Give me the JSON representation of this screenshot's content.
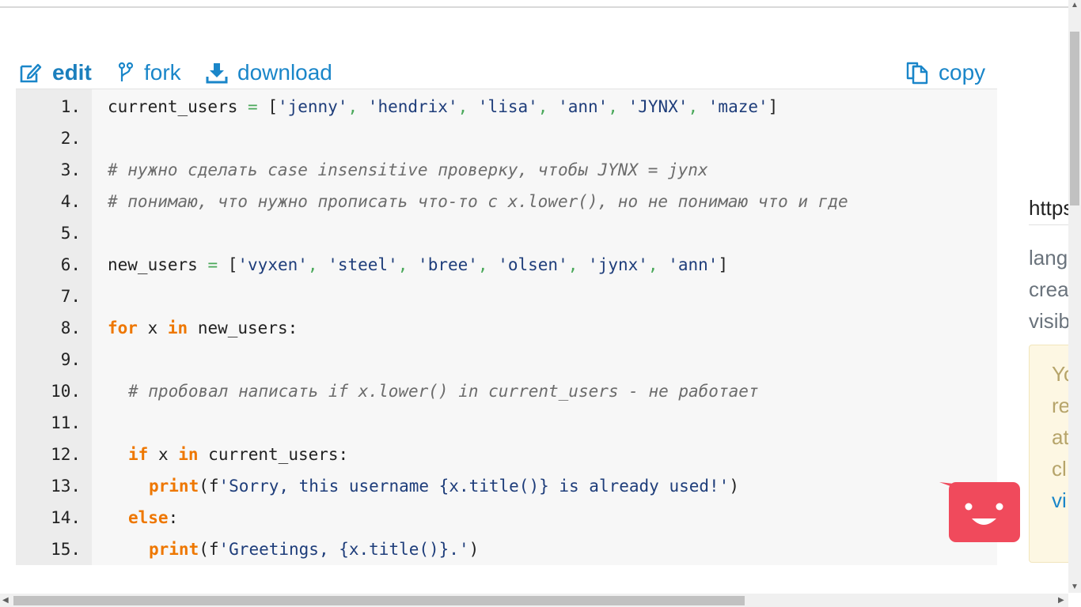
{
  "toolbar": {
    "edit": {
      "label": "edit",
      "icon": "edit-icon"
    },
    "fork": {
      "label": "fork",
      "icon": "fork-icon"
    },
    "download": {
      "label": "download",
      "icon": "download-icon"
    },
    "copy": {
      "label": "copy",
      "icon": "copy-icon"
    }
  },
  "code": {
    "line_numbers": [
      "1.",
      "2.",
      "3.",
      "4.",
      "5.",
      "6.",
      "7.",
      "8.",
      "9.",
      "10.",
      "11.",
      "12.",
      "13.",
      "14.",
      "15."
    ]
  },
  "sidebar": {
    "link_text": "https",
    "text_lines": [
      "lang",
      "crea",
      "visib"
    ],
    "note_lines": [
      "Yo",
      "re",
      "at",
      "cl"
    ],
    "note_link": "vi"
  },
  "colors": {
    "accent": "#1a86c9",
    "keyword": "#ee7700",
    "string": "#1e3d7a",
    "operator": "#4aa85a",
    "comment": "#6c6c6c",
    "chat_widget": "#f04a5c"
  }
}
